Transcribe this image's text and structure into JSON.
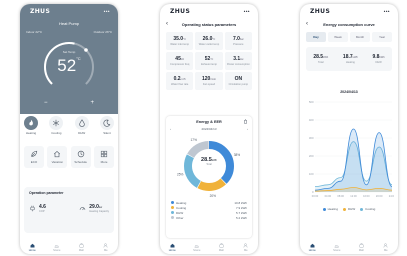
{
  "app_logo": "ZHUS",
  "status_signal": "••• ",
  "tabs": [
    "Home",
    "Scene",
    "Mall",
    "Me"
  ],
  "home": {
    "header_mode": "Heat Pump",
    "indoor_label": "Indoor 22°C",
    "outdoor_label": "Outdoor 26°C",
    "set_label": "Set Temp",
    "set_temp": "52",
    "set_unit": "°C",
    "modes": [
      {
        "label": "Heating",
        "icon": "flame-icon",
        "active": true
      },
      {
        "label": "Cooling",
        "icon": "snowflake-icon",
        "active": false
      },
      {
        "label": "DHW",
        "icon": "droplet-icon",
        "active": false
      },
      {
        "label": "Silent",
        "icon": "moon-icon",
        "active": false
      }
    ],
    "functions": [
      {
        "label": "ECO",
        "icon": "leaf-icon"
      },
      {
        "label": "Vacation",
        "icon": "house-icon"
      },
      {
        "label": "Schedule",
        "icon": "clock-icon"
      },
      {
        "label": "More",
        "icon": "grid-icon"
      }
    ],
    "operation_title": "Operation parameter",
    "op_items": [
      {
        "value": "4.6",
        "label": "COP",
        "icon": "plug-icon"
      },
      {
        "value": "29.0",
        "unit": "kw",
        "label": "Heating Capacity",
        "icon": "gauge-icon"
      }
    ]
  },
  "params": {
    "title": "Operating status parameters",
    "cells": [
      {
        "value": "35.0",
        "unit": "°C",
        "label": "Water inlet temp"
      },
      {
        "value": "26.0",
        "unit": "°C",
        "label": "Water outlet temp"
      },
      {
        "value": "7.0",
        "unit": "bar",
        "label": "Pressure"
      },
      {
        "value": "45",
        "unit": "Hz",
        "label": "Compressor freq"
      },
      {
        "value": "52",
        "unit": "°C",
        "label": "Exhaust temp"
      },
      {
        "value": "3.1",
        "unit": "kw",
        "label": "Power consumption"
      },
      {
        "value": "0.2",
        "unit": "m³/h",
        "label": "Water flow rate"
      },
      {
        "value": "120",
        "unit": "r/min",
        "label": "Fan speed"
      },
      {
        "value": "ON",
        "unit": "",
        "label": "Circulation pump"
      }
    ],
    "energy_title": "Energy & EER",
    "date": "2024/04/13",
    "donut_center": "28.5",
    "donut_center_unit": "kWh",
    "donut_center_label": "Total",
    "donut_slices": [
      {
        "name": "Heating",
        "percent": 38,
        "color": "#3f8ad8"
      },
      {
        "name": "Cooling",
        "percent": 20,
        "color": "#f0b23a"
      },
      {
        "name": "DHW",
        "percent": 25,
        "color": "#6fb7d9"
      },
      {
        "name": "Other",
        "percent": 17,
        "color": "#bfc7d1"
      }
    ],
    "legend": [
      {
        "name": "Heating",
        "value": "10.8 kWh",
        "color": "#3f8ad8"
      },
      {
        "name": "Cooling",
        "value": "7.9 kWh",
        "color": "#f0b23a"
      },
      {
        "name": "DHW",
        "value": "5.7 kWh",
        "color": "#6fb7d9"
      },
      {
        "name": "Other",
        "value": "5.2 kWh",
        "color": "#bfc7d1"
      }
    ]
  },
  "curve": {
    "title": "Energy consumption curve",
    "periods": [
      "Day",
      "Week",
      "Month",
      "Year"
    ],
    "active_period": "Day",
    "totals": [
      {
        "value": "28.5",
        "unit": "kWh",
        "label": "Total"
      },
      {
        "value": "18.7",
        "unit": "kWh",
        "label": "Heating"
      },
      {
        "value": "9.8",
        "unit": "kWh",
        "label": "DHW"
      }
    ],
    "date": "2024/04/13",
    "legend": [
      {
        "name": "Heating",
        "color": "#3f8ad8"
      },
      {
        "name": "DHW",
        "color": "#f0b23a"
      },
      {
        "name": "Cooling",
        "color": "#6fb7d9"
      }
    ]
  },
  "chart_data": {
    "type": "area",
    "x": [
      "00:00",
      "04:00",
      "08:00",
      "12:00",
      "16:00",
      "20:00",
      "24:00"
    ],
    "ylim": [
      0,
      500
    ],
    "yticks": [
      0,
      100,
      200,
      300,
      400,
      500
    ],
    "series": [
      {
        "name": "Heating",
        "color": "#3f8ad8",
        "values": [
          10,
          20,
          60,
          350,
          40,
          330,
          30
        ]
      },
      {
        "name": "DHW",
        "color": "#f0b23a",
        "values": [
          5,
          8,
          15,
          25,
          12,
          20,
          10
        ]
      },
      {
        "name": "Cooling",
        "color": "#6fb7d9",
        "values": [
          30,
          40,
          80,
          280,
          60,
          250,
          40
        ]
      }
    ],
    "grid": true,
    "legend": "bottom"
  }
}
